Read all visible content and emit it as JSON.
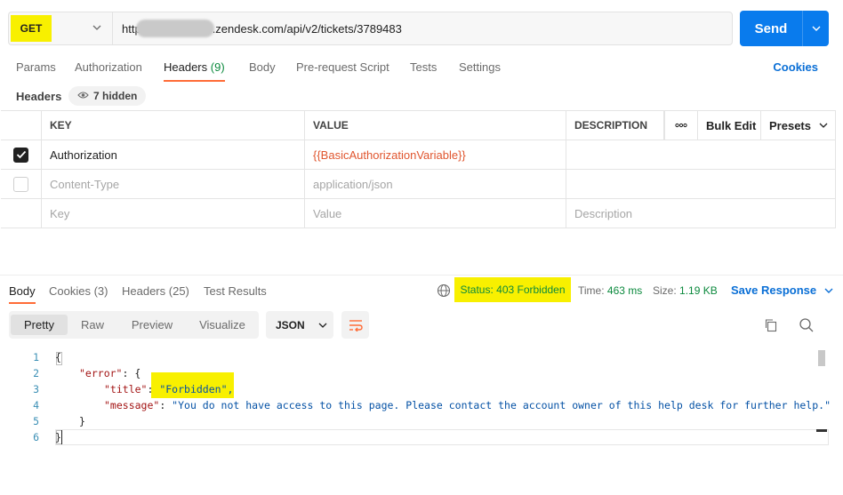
{
  "request": {
    "method": "GET",
    "url_prefix": "http",
    "url_suffix": ".zendesk.com/api/v2/tickets/3789483",
    "send_label": "Send"
  },
  "req_tabs": [
    {
      "label": "Params",
      "count": ""
    },
    {
      "label": "Authorization",
      "count": ""
    },
    {
      "label": "Headers",
      "count": "(9)"
    },
    {
      "label": "Body",
      "count": ""
    },
    {
      "label": "Pre-request Script",
      "count": ""
    },
    {
      "label": "Tests",
      "count": ""
    },
    {
      "label": "Settings",
      "count": ""
    }
  ],
  "cookies_link": "Cookies",
  "headers_section": {
    "label": "Headers",
    "hidden_badge": "7 hidden"
  },
  "table": {
    "columns": {
      "key": "KEY",
      "value": "VALUE",
      "description": "DESCRIPTION"
    },
    "more_label": "ooo",
    "bulk_edit": "Bulk Edit",
    "presets": "Presets",
    "rows": [
      {
        "checked": true,
        "key": "Authorization",
        "value": "{{BasicAuthorizationVariable}}",
        "description": ""
      },
      {
        "checked": false,
        "key": "Content-Type",
        "value": "application/json",
        "description": ""
      }
    ],
    "placeholder": {
      "key": "Key",
      "value": "Value",
      "description": "Description"
    }
  },
  "response": {
    "tabs": [
      {
        "label": "Body",
        "count": ""
      },
      {
        "label": "Cookies",
        "count": "(3)"
      },
      {
        "label": "Headers",
        "count": "(25)"
      },
      {
        "label": "Test Results",
        "count": ""
      }
    ],
    "status": "Status: 403 Forbidden",
    "time_label": "Time:",
    "time_value": "463 ms",
    "size_label": "Size:",
    "size_value": "1.19 KB",
    "save_response": "Save Response",
    "views": [
      "Pretty",
      "Raw",
      "Preview",
      "Visualize"
    ],
    "format": "JSON"
  },
  "code": {
    "line_numbers": [
      "1",
      "2",
      "3",
      "4",
      "5",
      "6"
    ],
    "l1": "{",
    "l2_key": "\"error\"",
    "l2_rest": ": {",
    "l3_key": "\"title\"",
    "l3_colon": ": ",
    "l3_val": "\"Forbidden\",",
    "l4_key": "\"message\"",
    "l4_colon": ": ",
    "l4_val": "\"You do not have access to this page. Please contact the account owner of this help desk for further help.\"",
    "l5": "}",
    "l6": "}"
  },
  "colors": {
    "accent": "#097bed",
    "tab_underline": "#ff6c37",
    "status_green": "#0c8a3e",
    "highlight": "#f8f000"
  }
}
